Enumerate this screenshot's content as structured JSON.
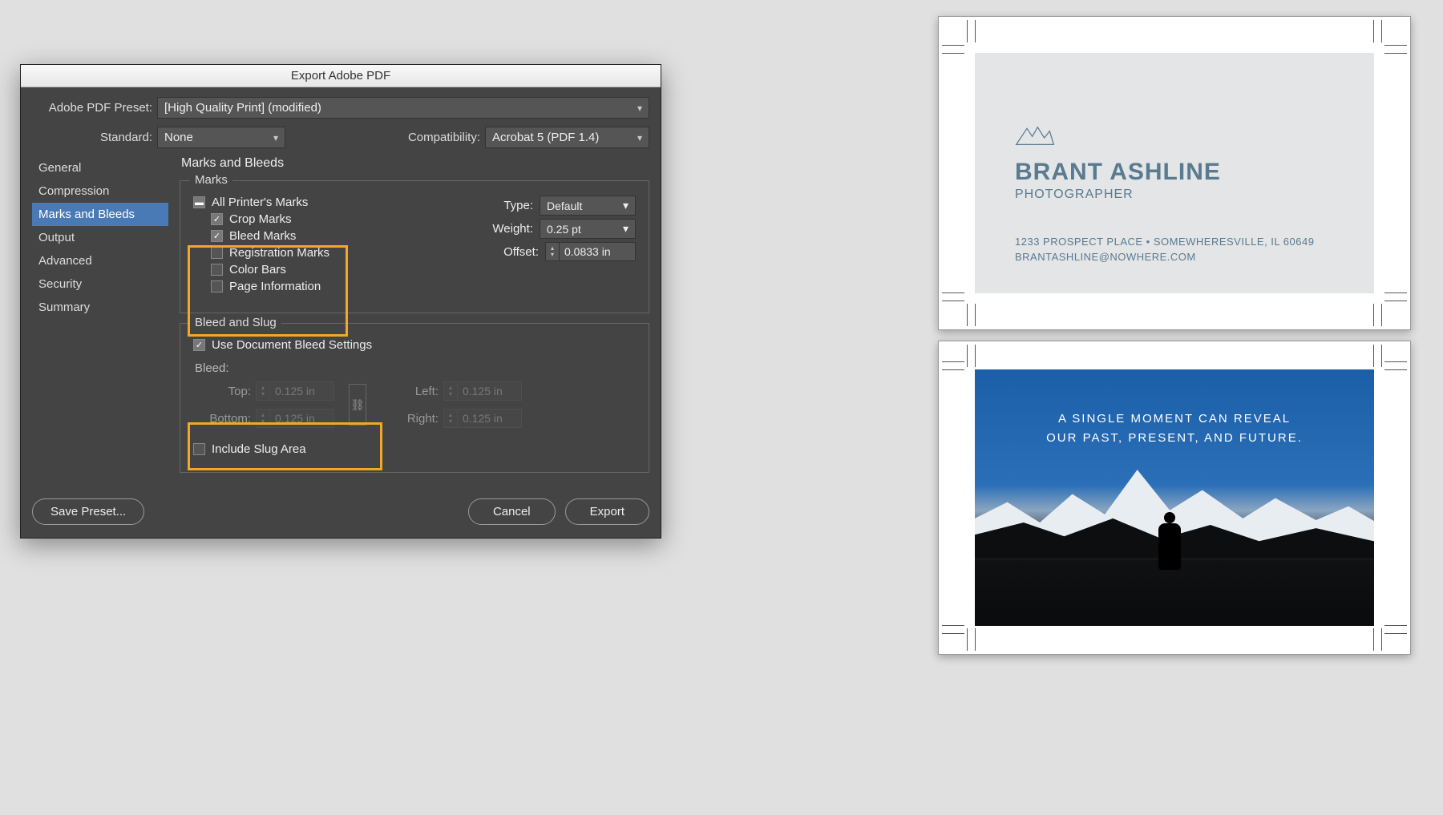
{
  "dialog": {
    "title": "Export Adobe PDF",
    "preset_label": "Adobe PDF Preset:",
    "preset_value": "[High Quality Print] (modified)",
    "standard_label": "Standard:",
    "standard_value": "None",
    "compat_label": "Compatibility:",
    "compat_value": "Acrobat 5 (PDF 1.4)",
    "sidebar": [
      "General",
      "Compression",
      "Marks and Bleeds",
      "Output",
      "Advanced",
      "Security",
      "Summary"
    ],
    "panel_title": "Marks and Bleeds",
    "marks": {
      "group_label": "Marks",
      "all": "All Printer's Marks",
      "crop": "Crop Marks",
      "bleed": "Bleed Marks",
      "reg": "Registration Marks",
      "color": "Color Bars",
      "page": "Page Information",
      "type_label": "Type:",
      "type_value": "Default",
      "weight_label": "Weight:",
      "weight_value": "0.25 pt",
      "offset_label": "Offset:",
      "offset_value": "0.0833 in"
    },
    "bleed": {
      "group_label": "Bleed and Slug",
      "use_doc": "Use Document Bleed Settings",
      "bleed_label": "Bleed:",
      "top": "Top:",
      "bottom": "Bottom:",
      "left": "Left:",
      "right": "Right:",
      "val": "0.125 in",
      "slug": "Include Slug Area"
    },
    "save_preset": "Save Preset...",
    "cancel": "Cancel",
    "export": "Export"
  },
  "card": {
    "name": "BRANT ASHLINE",
    "subtitle": "PHOTOGRAPHER",
    "address": "1233 PROSPECT PLACE  •  SOMEWHERESVILLE, IL 60649",
    "email": "BRANTASHLINE@NOWHERE.COM",
    "quote1": "A SINGLE MOMENT CAN REVEAL",
    "quote2": "OUR PAST, PRESENT, AND FUTURE."
  }
}
